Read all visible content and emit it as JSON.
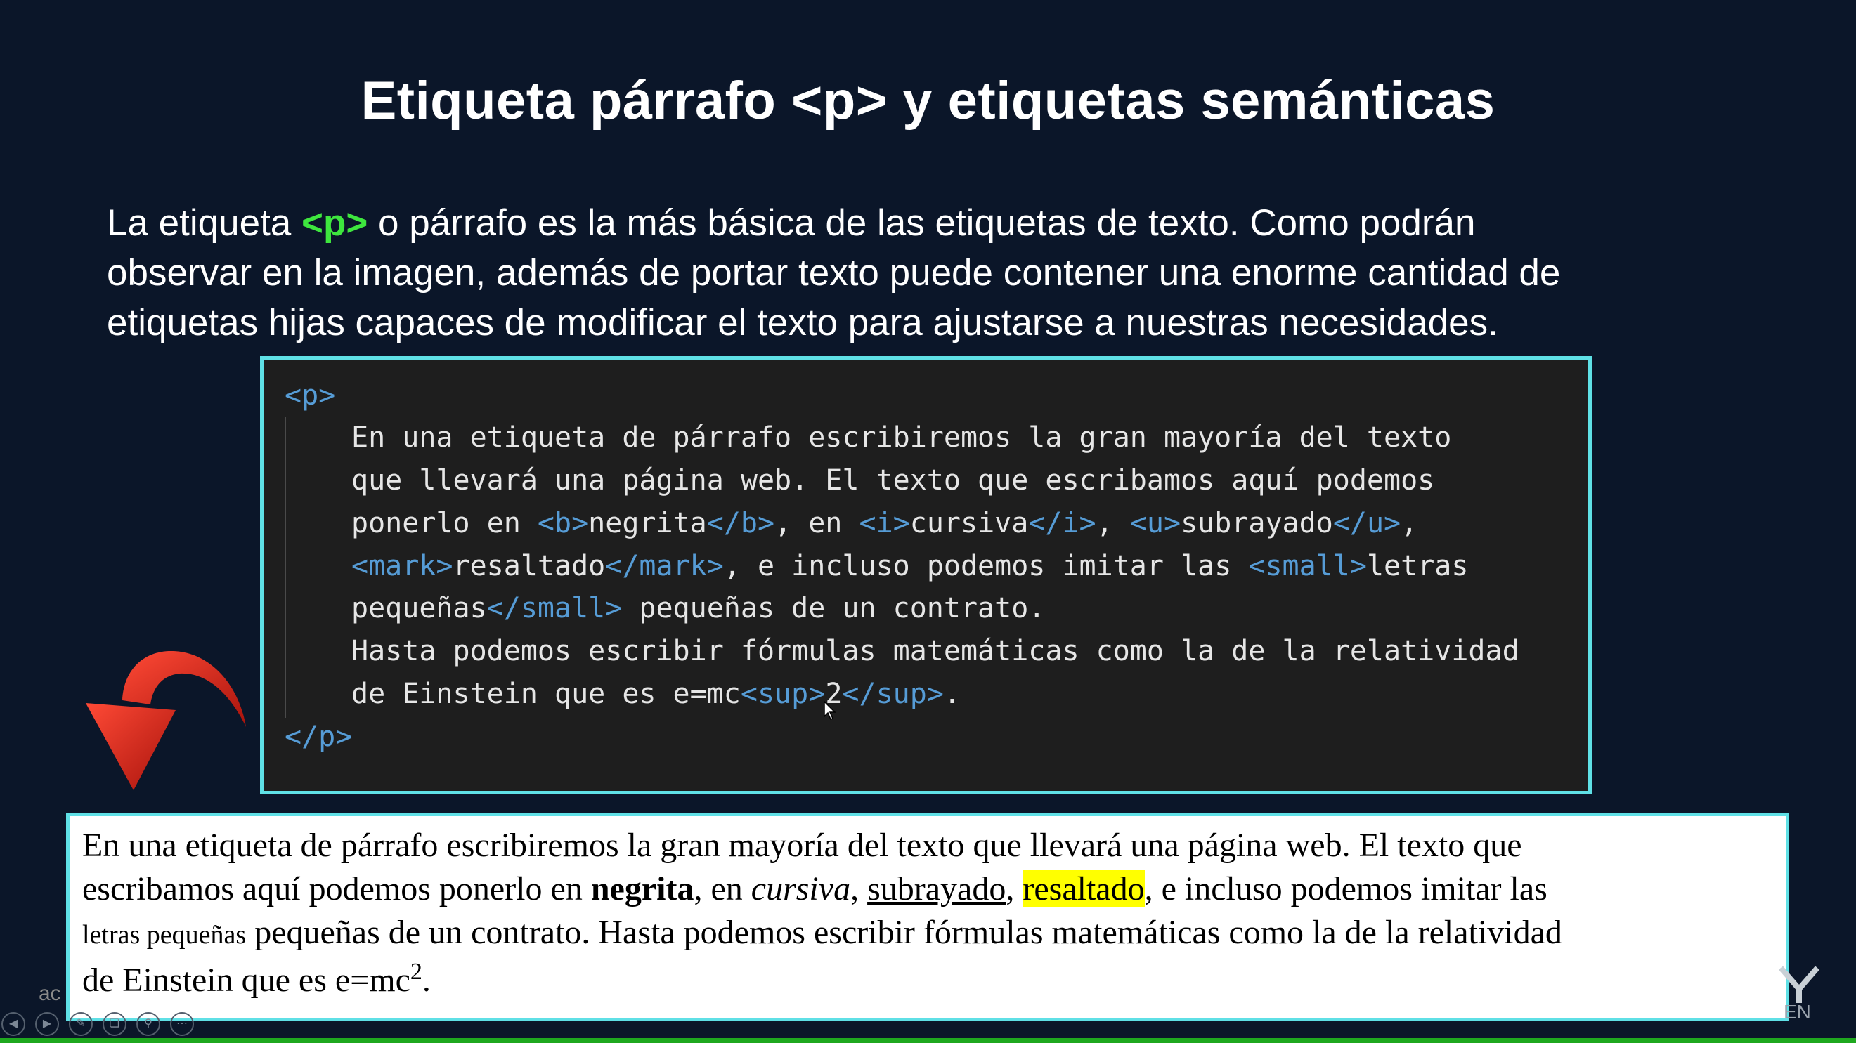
{
  "slide": {
    "title": "Etiqueta párrafo <p> y etiquetas semánticas",
    "intro": {
      "before": "La etiqueta ",
      "tag": "<p>",
      "line1_after": " o párrafo es la más básica de las etiquetas de texto. Como podrán",
      "line2": "observar en la imagen, además de portar texto puede contener una enorme cantidad de",
      "line3": "etiquetas hijas capaces de modificar el texto para ajustarse a nuestras necesidades."
    }
  },
  "code": {
    "open_tag": "<p>",
    "close_tag": "</p>",
    "line1": "En una etiqueta de párrafo escribiremos la gran mayoría del texto",
    "line2": "que llevará una página web. El texto que escribamos aquí podemos",
    "line3": {
      "t0": "ponerlo en ",
      "b_open": "<b>",
      "t1": "negrita",
      "b_close": "</b>",
      "t2": ", en ",
      "i_open": "<i>",
      "t3": "cursiva",
      "i_close": "</i>",
      "t4": ", ",
      "u_open": "<u>",
      "t5": "subrayado",
      "u_close": "</u>",
      "t6": ","
    },
    "line4": {
      "mark_open": "<mark>",
      "t0": "resaltado",
      "mark_close": "</mark>",
      "t1": ", e incluso podemos imitar las ",
      "small_open": "<small>",
      "t2": "letras"
    },
    "line5": {
      "t0": "pequeñas",
      "small_close": "</small>",
      "t1": " pequeñas de un contrato."
    },
    "line6": "Hasta podemos escribir fórmulas matemáticas como la de la relatividad",
    "line7": {
      "t0": "de Einstein que es e=mc",
      "sup_open": "<sup>",
      "t1": "2",
      "sup_close": "</sup>",
      "t2": "."
    }
  },
  "render": {
    "line1": "En una etiqueta de párrafo escribiremos la gran mayoría del texto que llevará una página web. El texto que",
    "line2": {
      "t0": "escribamos aquí podemos ponerlo en ",
      "bold": "negrita",
      "t1": ", en ",
      "italic": "cursiva",
      "t2": ", ",
      "underline": "subrayado",
      "t3": ", ",
      "mark": "resaltado",
      "t4": ", e incluso podemos imitar las"
    },
    "line3": {
      "small": "letras pequeñas",
      "t0": " pequeñas de un contrato. Hasta podemos escribir fórmulas matemáticas como la de la relatividad"
    },
    "line4": {
      "t0": "de Einstein que es e=mc",
      "sup": "2",
      "t1": "."
    }
  },
  "overlay": {
    "partial_text": "ac",
    "logo_text": "EN"
  },
  "icons": [
    "arrow-down-curved-icon",
    "prev-icon",
    "play-icon",
    "pen-icon",
    "copy-icon",
    "zoom-icon",
    "more-icon",
    "mouse-cursor-icon",
    "brand-logo-icon"
  ],
  "colors": {
    "background": "#0b1629",
    "tag_highlight": "#3ee63e",
    "frame": "#5fe0e6",
    "code_bg": "#1e1e1e",
    "code_tag": "#569cd6",
    "mark_yellow": "#ffff00",
    "progress_bar": "#1fa81f"
  }
}
